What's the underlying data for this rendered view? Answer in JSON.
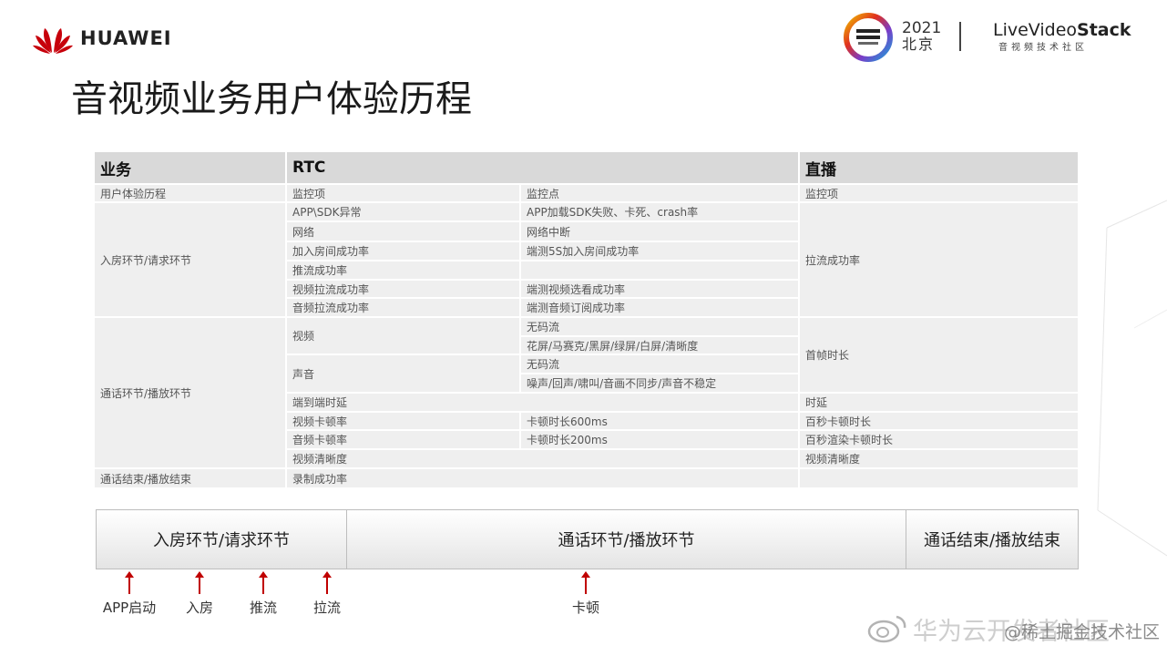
{
  "header": {
    "brand": "HUAWEI",
    "conference_year": "2021",
    "conference_city": "北京",
    "community_logo_pre": "LiveVideo",
    "community_logo_post": "Stack",
    "community_subtitle": "音视频技术社区"
  },
  "title": "音视频业务用户体验历程",
  "table": {
    "headers": {
      "business": "业务",
      "rtc": "RTC",
      "live": "直播"
    },
    "sub_headers": {
      "business": "用户体验历程",
      "rtc_item": "监控项",
      "rtc_point": "监控点",
      "live_item": "监控项"
    },
    "groups": {
      "join": "入房环节/请求环节",
      "call": "通话环节/播放环节",
      "end": "通话结束/播放结束"
    },
    "rtc_items": {
      "app_sdk": "APP\\SDK异常",
      "network": "网络",
      "join_rate": "加入房间成功率",
      "push_rate": "推流成功率",
      "video_pull_rate": "视频拉流成功率",
      "audio_pull_rate": "音频拉流成功率",
      "video": "视频",
      "audio": "声音",
      "e2e_latency": "端到端时延",
      "video_stall": "视频卡顿率",
      "audio_stall": "音频卡顿率",
      "video_clarity": "视频清晰度",
      "record_rate": "录制成功率"
    },
    "rtc_points": {
      "app_sdk": "APP加载SDK失败、卡死、crash率",
      "network": "网络中断",
      "join_rate": "端测5S加入房间成功率",
      "video_pull_rate": "端测视频选看成功率",
      "audio_pull_rate": "端测音频订阅成功率",
      "video_1": "无码流",
      "video_2": "花屏/马赛克/黑屏/绿屏/白屏/清晰度",
      "audio_1": "无码流",
      "audio_2": "噪声/回声/啸叫/音画不同步/声音不稳定",
      "video_stall": "卡顿时长600ms",
      "audio_stall": "卡顿时长200ms"
    },
    "live_items": {
      "pull_rate": "拉流成功率",
      "first_frame": "首帧时长",
      "latency": "时延",
      "stall_per_100s": "百秒卡顿时长",
      "render_stall_per_100s": "百秒渲染卡顿时长",
      "video_clarity": "视频清晰度"
    }
  },
  "phases": [
    "入房环节/请求环节",
    "通话环节/播放环节",
    "通话结束/播放结束"
  ],
  "markers": [
    "APP启动",
    "入房",
    "推流",
    "拉流",
    "卡顿"
  ],
  "watermark": {
    "text": "华为云开发者社区",
    "sub": "@稀土掘金技术社区"
  },
  "colors": {
    "huawei_red": "#c7000b",
    "arrow_red": "#c00000",
    "table_header": "#d9d9d9",
    "table_cell": "#efefef"
  }
}
